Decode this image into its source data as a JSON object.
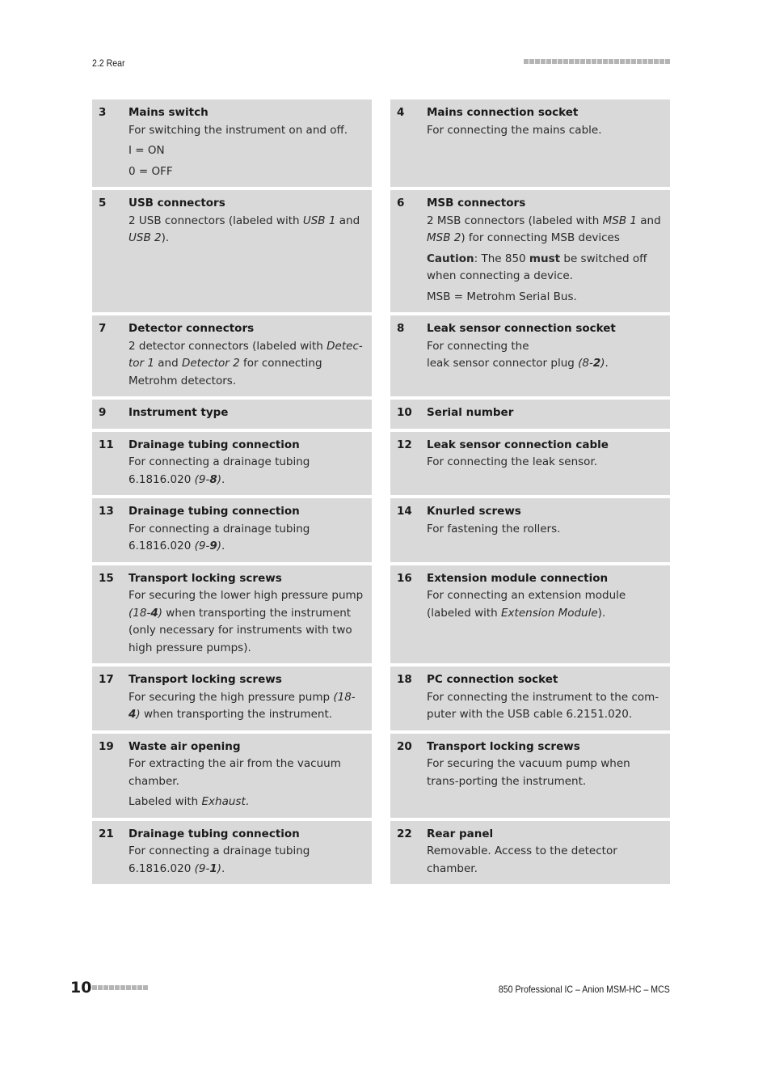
{
  "header": {
    "section": "2.2 Rear"
  },
  "footer": {
    "page_number": "10",
    "doc_title": "850 Professional IC – Anion MSM-HC – MCS"
  },
  "items": [
    {
      "num": "3",
      "title": "Mains switch",
      "lines": [
        "For switching the instrument on and off.",
        "I = ON",
        "0 = OFF"
      ]
    },
    {
      "num": "4",
      "title": "Mains connection socket",
      "lines": [
        "For connecting the mains cable."
      ]
    },
    {
      "num": "5",
      "title": "USB connectors",
      "lines": [
        "2 USB connectors (labeled with <i>USB 1</i> and <i>USB 2</i>)."
      ]
    },
    {
      "num": "6",
      "title": "MSB connectors",
      "lines": [
        "2 MSB connectors (labeled with <i>MSB 1</i> and <i>MSB 2</i>) for connecting MSB devices",
        "<b>Caution</b>: The 850 <b>must</b> be switched off when connecting a device.",
        "MSB = Metrohm Serial Bus."
      ]
    },
    {
      "num": "7",
      "title": "Detector connectors",
      "lines": [
        "2 detector connectors (labeled with <i>Detec-tor 1</i> and <i>Detector 2</i> for connecting Metrohm detectors."
      ]
    },
    {
      "num": "8",
      "title": "Leak sensor connection socket",
      "lines": [
        "For connecting the<br>leak sensor connector plug <i>(8-<b>2</b>)</i>."
      ]
    },
    {
      "num": "9",
      "title": "Instrument type",
      "lines": []
    },
    {
      "num": "10",
      "title": "Serial number",
      "lines": []
    },
    {
      "num": "11",
      "title": "Drainage tubing connection",
      "lines": [
        "For connecting a drainage tubing 6.1816.020 <i>(9-<b>8</b>)</i>."
      ]
    },
    {
      "num": "12",
      "title": "Leak sensor connection cable",
      "lines": [
        "For connecting the leak sensor."
      ]
    },
    {
      "num": "13",
      "title": "Drainage tubing connection",
      "lines": [
        "For connecting a drainage tubing 6.1816.020 <i>(9-<b>9</b>)</i>."
      ]
    },
    {
      "num": "14",
      "title": "Knurled screws",
      "lines": [
        "For fastening the rollers."
      ]
    },
    {
      "num": "15",
      "title": "Transport locking screws",
      "lines": [
        "For securing the lower high pressure pump <i>(18-<b>4</b>)</i> when transporting the instrument (only necessary for instruments with two high pressure pumps)."
      ]
    },
    {
      "num": "16",
      "title": "Extension module connection",
      "lines": [
        "For connecting an extension module (labeled with <i>Extension Module</i>)."
      ]
    },
    {
      "num": "17",
      "title": "Transport locking screws",
      "lines": [
        "For securing the high pressure pump <i>(18-<b>4</b>)</i> when transporting the instrument."
      ]
    },
    {
      "num": "18",
      "title": "PC connection socket",
      "lines": [
        "For connecting the instrument to the com-puter with the USB cable 6.2151.020."
      ]
    },
    {
      "num": "19",
      "title": "Waste air opening",
      "lines": [
        "For extracting the air from the vacuum chamber.",
        "Labeled with <i>Exhaust</i>."
      ]
    },
    {
      "num": "20",
      "title": "Transport locking screws",
      "lines": [
        "For securing the vacuum pump when trans-porting the instrument."
      ]
    },
    {
      "num": "21",
      "title": "Drainage tubing connection",
      "lines": [
        "For connecting a drainage tubing 6.1816.020 <i>(9-<b>1</b>)</i>."
      ]
    },
    {
      "num": "22",
      "title": "Rear panel",
      "lines": [
        "Removable. Access to the detector chamber."
      ]
    }
  ]
}
